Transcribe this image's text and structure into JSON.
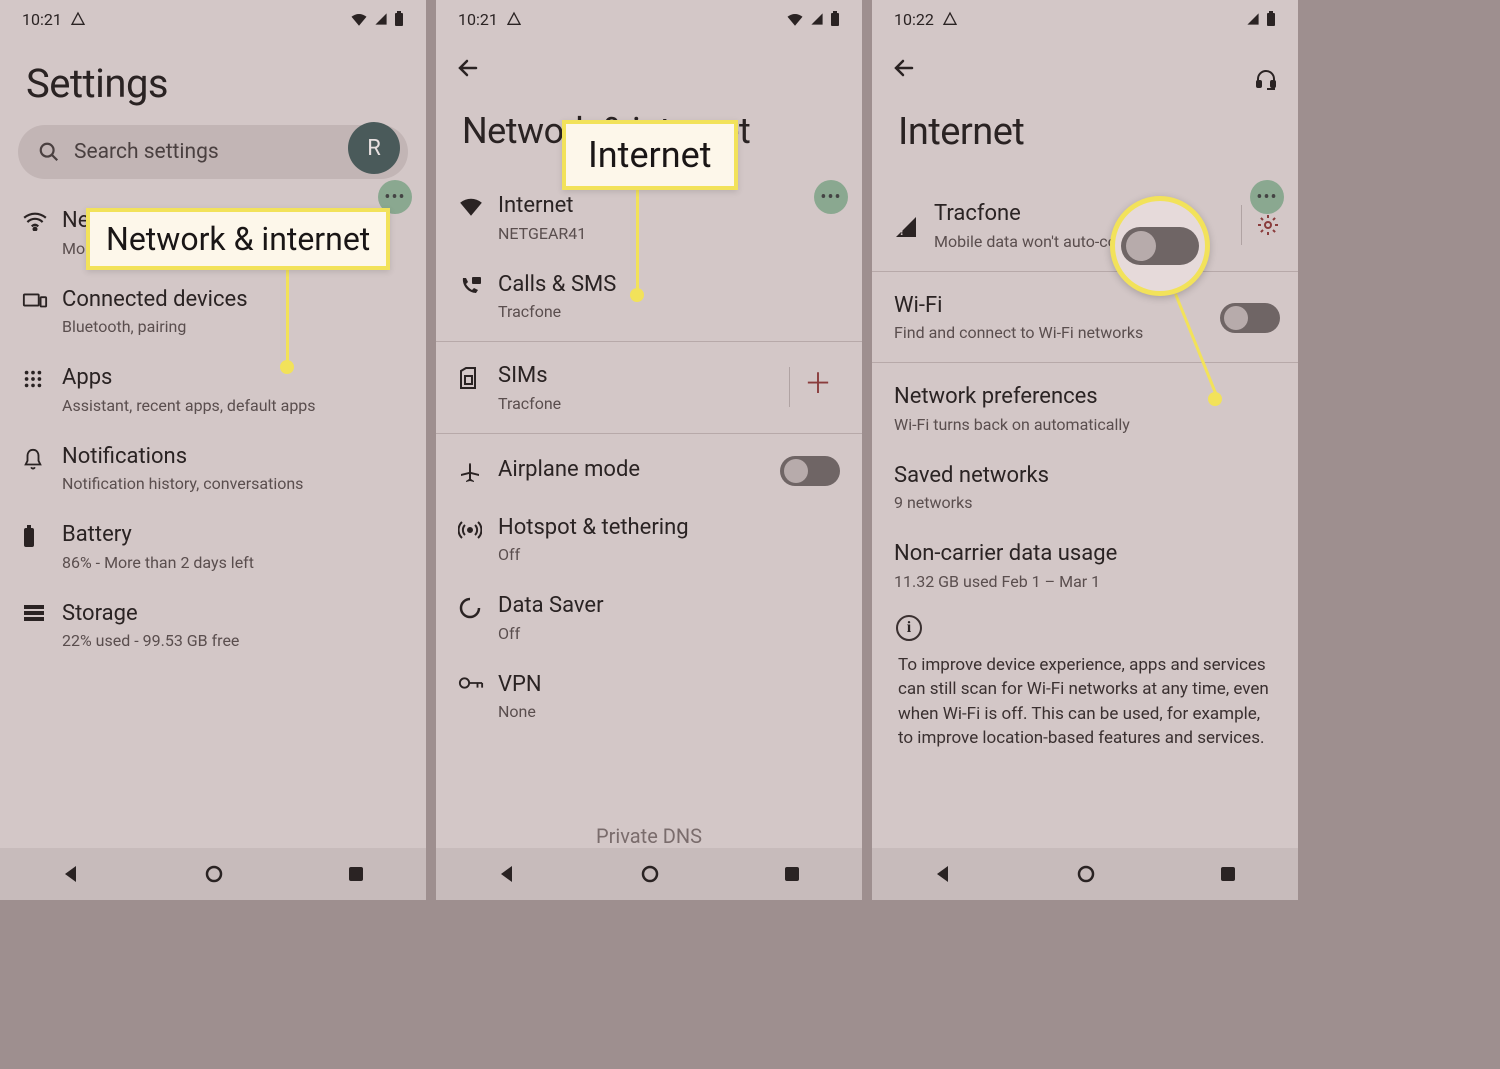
{
  "colors": {
    "bg": "#d3c7c7",
    "accent_green": "#8aa890",
    "accent_red": "#8a3c3c",
    "highlight": "#f2e25a"
  },
  "callouts": {
    "network_internet": "Network & internet",
    "internet": "Internet"
  },
  "screen1": {
    "status": {
      "time": "10:21"
    },
    "title": "Settings",
    "avatar_initial": "R",
    "search_placeholder": "Search settings",
    "items": [
      {
        "title": "Network & internet",
        "sub": "Mobile, Wi-Fi, hotspot",
        "icon": "wifi-icon"
      },
      {
        "title": "Connected devices",
        "sub": "Bluetooth, pairing",
        "icon": "devices-icon"
      },
      {
        "title": "Apps",
        "sub": "Assistant, recent apps, default apps",
        "icon": "apps-icon"
      },
      {
        "title": "Notifications",
        "sub": "Notification history, conversations",
        "icon": "bell-icon"
      },
      {
        "title": "Battery",
        "sub": "86% - More than 2 days left",
        "icon": "battery-icon"
      },
      {
        "title": "Storage",
        "sub": "22% used - 99.53 GB free",
        "icon": "storage-icon"
      }
    ]
  },
  "screen2": {
    "status": {
      "time": "10:21"
    },
    "title": "Network & internet",
    "items": [
      {
        "title": "Internet",
        "sub": "NETGEAR41",
        "icon": "wifi-filled-icon"
      },
      {
        "title": "Calls & SMS",
        "sub": "Tracfone",
        "icon": "phone-sms-icon"
      },
      {
        "title": "SIMs",
        "sub": "Tracfone",
        "icon": "sim-icon",
        "trailing": "add"
      },
      {
        "title": "Airplane mode",
        "sub": "",
        "icon": "airplane-icon",
        "trailing": "toggle"
      },
      {
        "title": "Hotspot & tethering",
        "sub": "Off",
        "icon": "hotspot-icon"
      },
      {
        "title": "Data Saver",
        "sub": "Off",
        "icon": "datasaver-icon"
      },
      {
        "title": "VPN",
        "sub": "None",
        "icon": "vpn-icon"
      }
    ],
    "cutoff": "Private DNS"
  },
  "screen3": {
    "status": {
      "time": "10:22"
    },
    "title": "Internet",
    "carrier": {
      "name": "Tracfone",
      "sub": "Mobile data won't auto-connect"
    },
    "wifi": {
      "title": "Wi-Fi",
      "sub": "Find and connect to Wi-Fi networks"
    },
    "items": [
      {
        "title": "Network preferences",
        "sub": "Wi-Fi turns back on automatically"
      },
      {
        "title": "Saved networks",
        "sub": "9 networks"
      },
      {
        "title": "Non-carrier data usage",
        "sub": "11.32 GB used Feb 1 – Mar 1"
      }
    ],
    "footer_text": "To improve device experience, apps and services can still scan for Wi-Fi networks at any time, even when Wi-Fi is off. This can be used, for example, to improve location-based features and services."
  }
}
